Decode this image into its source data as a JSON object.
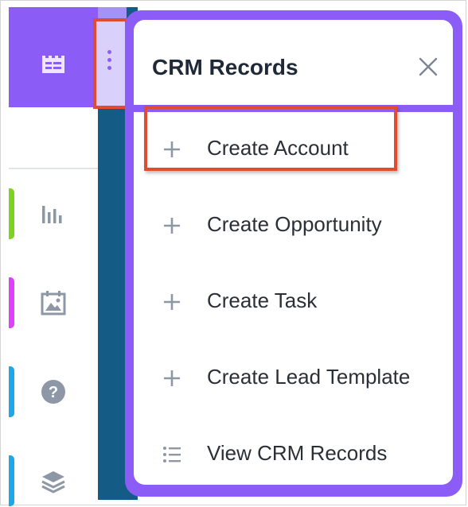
{
  "menu": {
    "title": "CRM Records",
    "items": [
      {
        "label": "Create Account",
        "icon": "plus-icon"
      },
      {
        "label": "Create Opportunity",
        "icon": "plus-icon"
      },
      {
        "label": "Create Task",
        "icon": "plus-icon"
      },
      {
        "label": "Create Lead Template",
        "icon": "plus-icon"
      },
      {
        "label": "View CRM Records",
        "icon": "list-icon"
      }
    ]
  },
  "sidebar": {
    "icons": [
      "dashboard-card-icon",
      "bar-chart-icon",
      "calendar-icon",
      "help-circle-icon",
      "layers-icon"
    ]
  },
  "colors": {
    "accent": "#8b5cf6",
    "dark_strip": "#145b85",
    "highlight": "#e14b30",
    "tab_green": "#7ed321",
    "tab_magenta": "#e040fb",
    "tab_blue_1": "#1ba7e8",
    "tab_blue_2": "#1ba7e8"
  }
}
